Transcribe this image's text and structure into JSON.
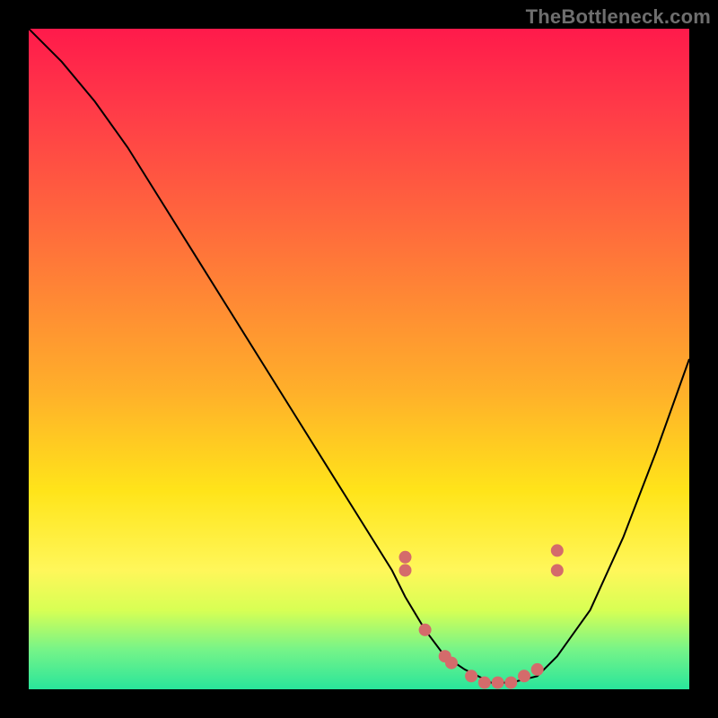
{
  "watermark": "TheBottleneck.com",
  "chart_data": {
    "type": "line",
    "title": "",
    "xlabel": "",
    "ylabel": "",
    "xlim": [
      0,
      100
    ],
    "ylim": [
      0,
      100
    ],
    "series": [
      {
        "name": "bottleneck-curve",
        "x": [
          0,
          5,
          10,
          15,
          20,
          25,
          30,
          35,
          40,
          45,
          50,
          55,
          57,
          60,
          63,
          66,
          70,
          73,
          77,
          80,
          85,
          90,
          95,
          100
        ],
        "y": [
          100,
          95,
          89,
          82,
          74,
          66,
          58,
          50,
          42,
          34,
          26,
          18,
          14,
          9,
          5,
          3,
          1,
          1,
          2,
          5,
          12,
          23,
          36,
          50
        ]
      }
    ],
    "markers": {
      "name": "highlight-points",
      "color": "#d46b6b",
      "x": [
        57,
        57,
        60,
        63,
        64,
        67,
        69,
        71,
        73,
        75,
        77,
        80,
        80
      ],
      "y": [
        20,
        18,
        9,
        5,
        4,
        2,
        1,
        1,
        1,
        2,
        3,
        18,
        21
      ]
    }
  }
}
